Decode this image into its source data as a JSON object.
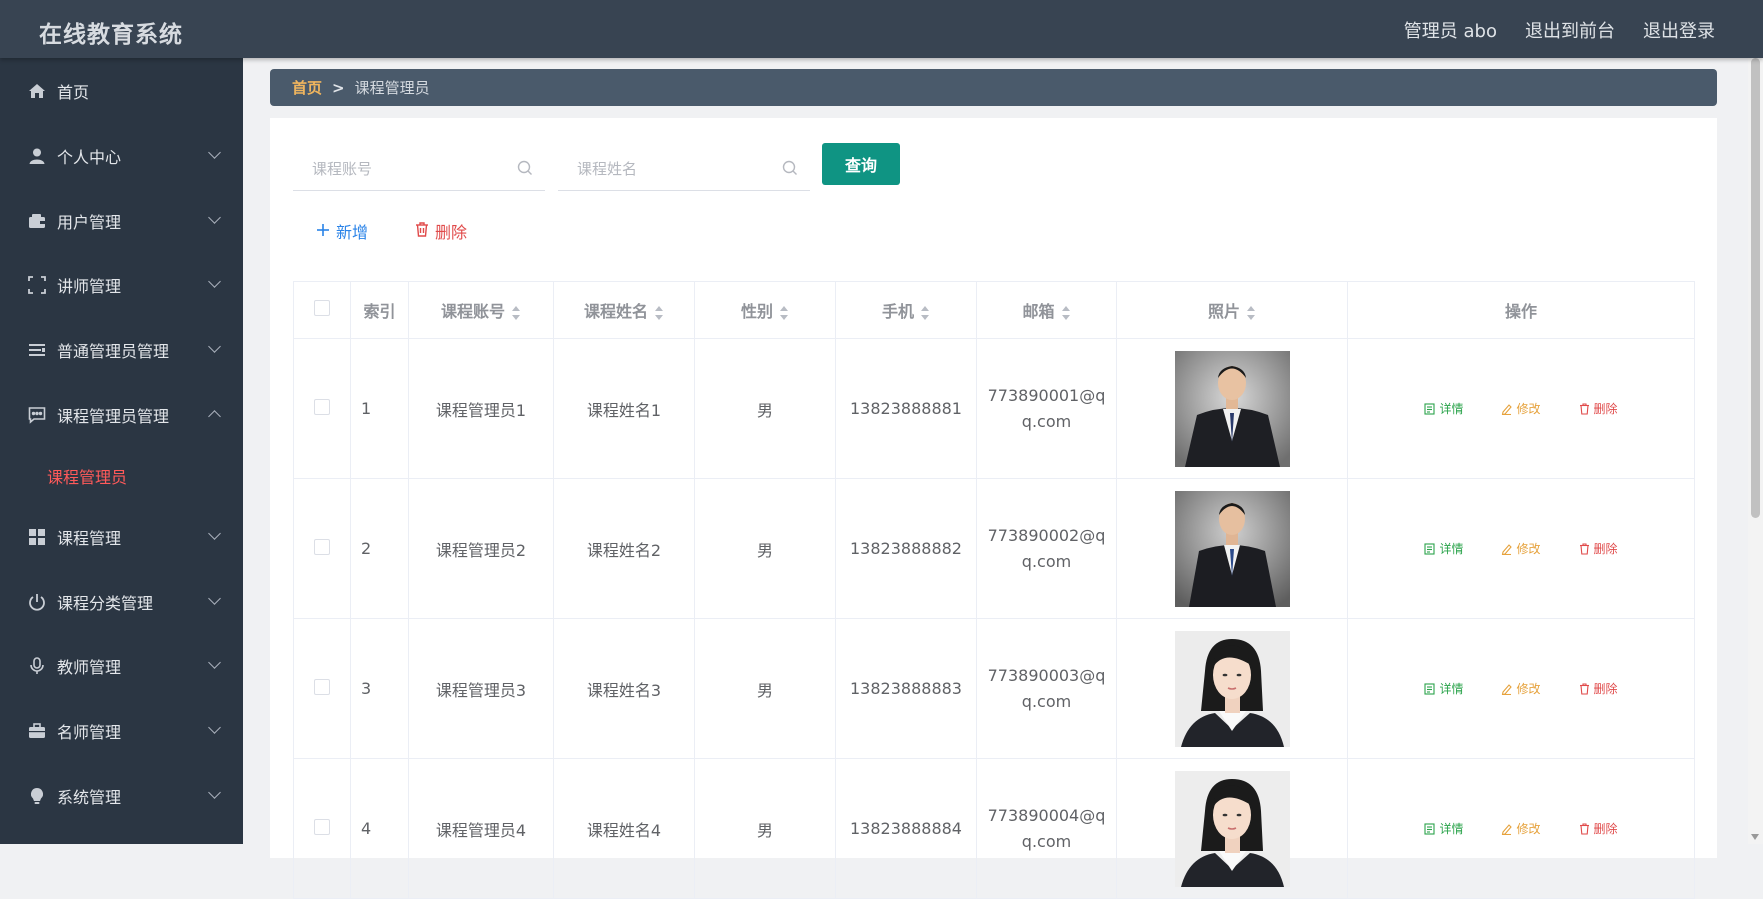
{
  "header": {
    "title": "在线教育系统",
    "nav": [
      "管理员 abo",
      "退出到前台",
      "退出登录"
    ]
  },
  "sidebar": {
    "items": [
      {
        "label": "首页",
        "icon": "home-icon"
      },
      {
        "label": "个人中心",
        "icon": "user-icon"
      },
      {
        "label": "用户管理",
        "icon": "wallet-icon"
      },
      {
        "label": "讲师管理",
        "icon": "frame-icon"
      },
      {
        "label": "普通管理员管理",
        "icon": "list-icon"
      },
      {
        "label": "课程管理员管理",
        "icon": "chat-icon"
      },
      {
        "label": "课程管理",
        "icon": "grid-icon"
      },
      {
        "label": "课程分类管理",
        "icon": "power-icon"
      },
      {
        "label": "教师管理",
        "icon": "mic-icon"
      },
      {
        "label": "名师管理",
        "icon": "briefcase-icon"
      },
      {
        "label": "系统管理",
        "icon": "bulb-icon"
      }
    ],
    "active_sub": "课程管理员"
  },
  "breadcrumb": {
    "home": "首页",
    "sep": ">",
    "current": "课程管理员"
  },
  "search": {
    "account_placeholder": "课程账号",
    "name_placeholder": "课程姓名",
    "query_label": "查询"
  },
  "actions": {
    "add_label": "新增",
    "delete_label": "删除"
  },
  "table": {
    "headers": [
      "索引",
      "课程账号",
      "课程姓名",
      "性别",
      "手机",
      "邮箱",
      "照片",
      "操作"
    ],
    "rows": [
      {
        "index": "1",
        "account": "课程管理员1",
        "name": "课程姓名1",
        "gender": "男",
        "phone": "13823888881",
        "email": "773890001@qq.com"
      },
      {
        "index": "2",
        "account": "课程管理员2",
        "name": "课程姓名2",
        "gender": "男",
        "phone": "13823888882",
        "email": "773890002@qq.com"
      },
      {
        "index": "3",
        "account": "课程管理员3",
        "name": "课程姓名3",
        "gender": "男",
        "phone": "13823888883",
        "email": "773890003@qq.com"
      },
      {
        "index": "4",
        "account": "课程管理员4",
        "name": "课程姓名4",
        "gender": "男",
        "phone": "13823888884",
        "email": "773890004@qq.com"
      }
    ],
    "ops": {
      "detail": "详情",
      "edit": "修改",
      "delete": "删除"
    }
  },
  "colors": {
    "header_bg": "#384452",
    "sidebar_bg": "#2b3643",
    "breadcrumb_bg": "#4a5a6b",
    "accent_query": "#0f9483",
    "active_sub": "#ff5a5a"
  }
}
